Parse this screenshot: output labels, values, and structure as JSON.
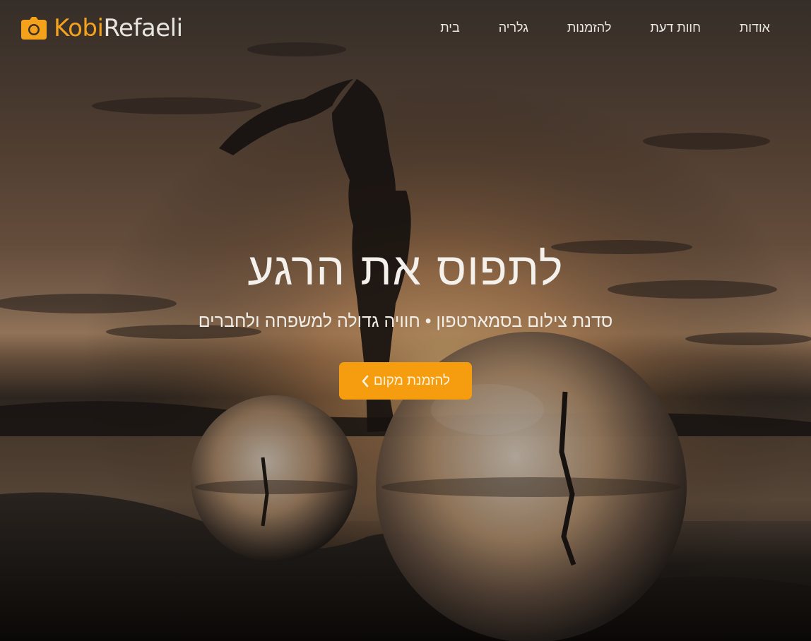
{
  "brand": {
    "part1": "Kobi",
    "part2": "Refaeli",
    "icon": "camera-icon"
  },
  "nav": {
    "items": [
      {
        "label": "בית"
      },
      {
        "label": "גלריה"
      },
      {
        "label": "להזמנות"
      },
      {
        "label": "חוות דעת"
      },
      {
        "label": "אודות"
      }
    ]
  },
  "hero": {
    "title": "לתפוס את הרגע",
    "subtitle": "סדנת צילום בסמארטפון • חוויה גדולה למשפחה ולחברים",
    "cta_label": "להזמנת מקום",
    "cta_icon": "chevron-left-icon"
  },
  "colors": {
    "accent": "#f59c0f",
    "brand_accent": "#f4a21c",
    "nav_text": "#ece8e2"
  }
}
